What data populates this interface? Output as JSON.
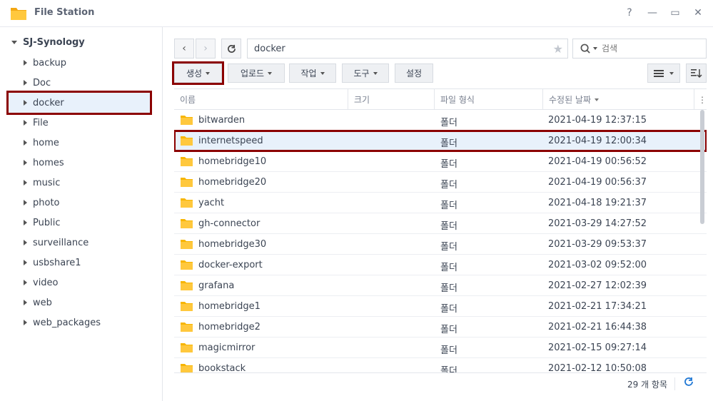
{
  "window": {
    "title": "File Station",
    "help": "?",
    "minimize": "—",
    "maximize": "▭",
    "close": "✕"
  },
  "sidebar": {
    "root": "SJ-Synology",
    "items": [
      "backup",
      "Doc",
      "docker",
      "File",
      "home",
      "homes",
      "music",
      "photo",
      "Public",
      "surveillance",
      "usbshare1",
      "video",
      "web",
      "web_packages"
    ],
    "selected": "docker"
  },
  "toolbar": {
    "path": "docker",
    "search_placeholder": "검색",
    "buttons": [
      "생성",
      "업로드",
      "작업",
      "도구",
      "설정"
    ]
  },
  "columns": {
    "name": "이름",
    "size": "크기",
    "type": "파일 형식",
    "modified": "수정된 날짜"
  },
  "files": [
    {
      "name": "bitwarden",
      "type": "폴더",
      "modified": "2021-04-19 12:37:15"
    },
    {
      "name": "internetspeed",
      "type": "폴더",
      "modified": "2021-04-19 12:00:34"
    },
    {
      "name": "homebridge10",
      "type": "폴더",
      "modified": "2021-04-19 00:56:52"
    },
    {
      "name": "homebridge20",
      "type": "폴더",
      "modified": "2021-04-19 00:56:37"
    },
    {
      "name": "yacht",
      "type": "폴더",
      "modified": "2021-04-18 19:21:37"
    },
    {
      "name": "gh-connector",
      "type": "폴더",
      "modified": "2021-03-29 14:27:52"
    },
    {
      "name": "homebridge30",
      "type": "폴더",
      "modified": "2021-03-29 09:53:37"
    },
    {
      "name": "docker-export",
      "type": "폴더",
      "modified": "2021-03-02 09:52:00"
    },
    {
      "name": "grafana",
      "type": "폴더",
      "modified": "2021-02-27 12:02:39"
    },
    {
      "name": "homebridge1",
      "type": "폴더",
      "modified": "2021-02-21 17:34:21"
    },
    {
      "name": "homebridge2",
      "type": "폴더",
      "modified": "2021-02-21 16:44:38"
    },
    {
      "name": "magicmirror",
      "type": "폴더",
      "modified": "2021-02-15 09:27:14"
    },
    {
      "name": "bookstack",
      "type": "폴더",
      "modified": "2021-02-12 10:50:08"
    }
  ],
  "selected_file": "internetspeed",
  "footer": {
    "count": "29 개 항목"
  },
  "colors": {
    "folder": "#f7b500",
    "selection": "#e8f1fb",
    "highlight": "#8b0000",
    "accent": "#1f77d4"
  }
}
